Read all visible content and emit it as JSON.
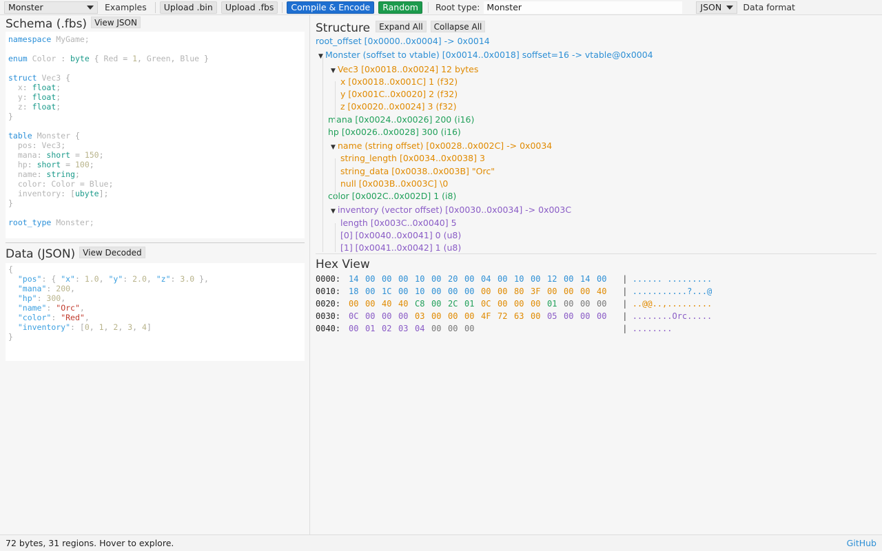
{
  "toolbar": {
    "schema_select": "Monster",
    "examples": "Examples",
    "upload_bin": "Upload .bin",
    "upload_fbs": "Upload .fbs",
    "compile": "Compile & Encode",
    "random": "Random",
    "root_type_label": "Root type:",
    "root_type_value": "Monster",
    "format_select": "JSON",
    "data_format_label": "Data format"
  },
  "schema": {
    "title": "Schema (.fbs)",
    "view_json": "View JSON"
  },
  "data_panel": {
    "title": "Data (JSON)",
    "view_decoded": "View Decoded"
  },
  "structure": {
    "title": "Structure",
    "expand_all": "Expand All",
    "collapse_all": "Collapse All",
    "nodes": [
      {
        "text": "root_offset [0x0000..0x0004] -> 0x0014",
        "color": "blue",
        "indent": 0,
        "toggle": false
      },
      {
        "text": "Monster (soffset to vtable) [0x0014..0x0018] soffset=16 -> vtable@0x0004",
        "color": "blue",
        "indent": 0,
        "toggle": true
      },
      {
        "text": "Vec3 [0x0018..0x0024] 12 bytes",
        "color": "orange",
        "indent": 1,
        "toggle": true
      },
      {
        "text": "x [0x0018..0x001C] 1 (f32)",
        "color": "orange",
        "indent": 2,
        "toggle": false
      },
      {
        "text": "y [0x001C..0x0020] 2 (f32)",
        "color": "orange",
        "indent": 2,
        "toggle": false
      },
      {
        "text": "z [0x0020..0x0024] 3 (f32)",
        "color": "orange",
        "indent": 2,
        "toggle": false
      },
      {
        "text": "mana [0x0024..0x0026] 200 (i16)",
        "color": "green",
        "indent": 1,
        "toggle": false
      },
      {
        "text": "hp [0x0026..0x0028] 300 (i16)",
        "color": "green",
        "indent": 1,
        "toggle": false
      },
      {
        "text": "name (string offset) [0x0028..0x002C] -> 0x0034",
        "color": "orange",
        "indent": 1,
        "toggle": true
      },
      {
        "text": "string_length [0x0034..0x0038] 3",
        "color": "orange",
        "indent": 2,
        "toggle": false
      },
      {
        "text": "string_data [0x0038..0x003B] \"Orc\"",
        "color": "orange",
        "indent": 2,
        "toggle": false
      },
      {
        "text": "null [0x003B..0x003C] \\0",
        "color": "orange",
        "indent": 2,
        "toggle": false
      },
      {
        "text": "color [0x002C..0x002D] 1 (i8)",
        "color": "green",
        "indent": 1,
        "toggle": false
      },
      {
        "text": "inventory (vector offset) [0x0030..0x0034] -> 0x003C",
        "color": "purple",
        "indent": 1,
        "toggle": true
      },
      {
        "text": "length [0x003C..0x0040] 5",
        "color": "purple",
        "indent": 2,
        "toggle": false
      },
      {
        "text": "[0] [0x0040..0x0041] 0 (u8)",
        "color": "purple",
        "indent": 2,
        "toggle": false
      },
      {
        "text": "[1] [0x0041..0x0042] 1 (u8)",
        "color": "purple",
        "indent": 2,
        "toggle": false
      }
    ]
  },
  "hex": {
    "title": "Hex View",
    "rows": [
      {
        "addr": "0000:",
        "bytes": [
          [
            "14",
            0
          ],
          [
            "00",
            0
          ],
          [
            "00",
            0
          ],
          [
            "00",
            0
          ],
          [
            "10",
            0
          ],
          [
            "00",
            0
          ],
          [
            "20",
            0
          ],
          [
            "00",
            0
          ],
          [
            "04",
            0
          ],
          [
            "00",
            0
          ],
          [
            "10",
            0
          ],
          [
            "00",
            0
          ],
          [
            "12",
            0
          ],
          [
            "00",
            0
          ],
          [
            "14",
            0
          ],
          [
            "00",
            0
          ]
        ],
        "ascii": "...... ........."
      },
      {
        "addr": "0010:",
        "bytes": [
          [
            "18",
            0
          ],
          [
            "00",
            0
          ],
          [
            "1C",
            0
          ],
          [
            "00",
            0
          ],
          [
            "10",
            0
          ],
          [
            "00",
            0
          ],
          [
            "00",
            0
          ],
          [
            "00",
            0
          ],
          [
            "00",
            1
          ],
          [
            "00",
            1
          ],
          [
            "80",
            1
          ],
          [
            "3F",
            1
          ],
          [
            "00",
            1
          ],
          [
            "00",
            1
          ],
          [
            "00",
            1
          ],
          [
            "40",
            1
          ]
        ],
        "ascii": "...........?...@"
      },
      {
        "addr": "0020:",
        "bytes": [
          [
            "00",
            1
          ],
          [
            "00",
            1
          ],
          [
            "40",
            1
          ],
          [
            "40",
            1
          ],
          [
            "C8",
            2
          ],
          [
            "00",
            2
          ],
          [
            "2C",
            2
          ],
          [
            "01",
            2
          ],
          [
            "0C",
            1
          ],
          [
            "00",
            1
          ],
          [
            "00",
            1
          ],
          [
            "00",
            1
          ],
          [
            "01",
            2
          ],
          [
            "00",
            4
          ],
          [
            "00",
            4
          ],
          [
            "00",
            4
          ]
        ],
        "ascii": "..@@..,........."
      },
      {
        "addr": "0030:",
        "bytes": [
          [
            "0C",
            3
          ],
          [
            "00",
            3
          ],
          [
            "00",
            3
          ],
          [
            "00",
            3
          ],
          [
            "03",
            1
          ],
          [
            "00",
            1
          ],
          [
            "00",
            1
          ],
          [
            "00",
            1
          ],
          [
            "4F",
            1
          ],
          [
            "72",
            1
          ],
          [
            "63",
            1
          ],
          [
            "00",
            1
          ],
          [
            "05",
            3
          ],
          [
            "00",
            3
          ],
          [
            "00",
            3
          ],
          [
            "00",
            3
          ]
        ],
        "ascii": "........Orc....."
      },
      {
        "addr": "0040:",
        "bytes": [
          [
            "00",
            3
          ],
          [
            "01",
            3
          ],
          [
            "02",
            3
          ],
          [
            "03",
            3
          ],
          [
            "04",
            3
          ],
          [
            "00",
            4
          ],
          [
            "00",
            4
          ],
          [
            "00",
            4
          ]
        ],
        "ascii": "........"
      }
    ]
  },
  "status": {
    "text": "72 bytes, 31 regions. Hover to explore.",
    "github": "GitHub"
  },
  "colors": {
    "blue": "#2d8fd5",
    "orange": "#e08a00",
    "green": "#21a05a",
    "purple": "#8a5cc6",
    "compile_button": "#1e6fd1",
    "random_button": "#1c9b4d"
  }
}
